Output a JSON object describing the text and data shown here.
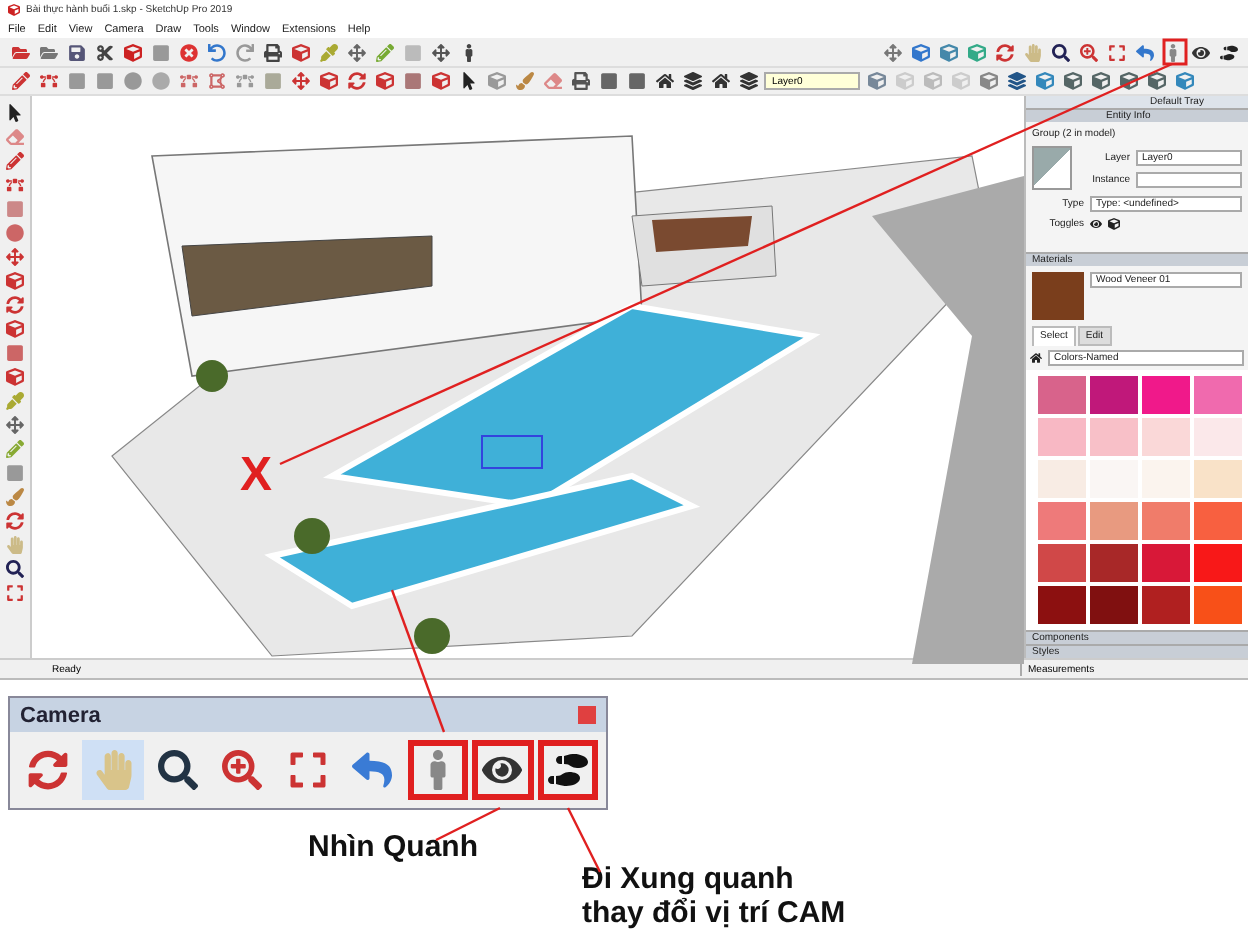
{
  "window": {
    "title": "Bài thực hành buổi 1.skp - SketchUp Pro 2019"
  },
  "menu": [
    "File",
    "Edit",
    "View",
    "Camera",
    "Draw",
    "Tools",
    "Window",
    "Extensions",
    "Help"
  ],
  "layer_field": {
    "value": "Layer0"
  },
  "viewport": {
    "marker": "X"
  },
  "tray": {
    "title": "Default Tray",
    "entity_info": {
      "title": "Entity Info",
      "heading": "Group (2 in model)",
      "layer_label": "Layer",
      "layer_value": "Layer0",
      "instance_label": "Instance",
      "type_label": "Type",
      "type_value": "Type: <undefined>",
      "toggles_label": "Toggles"
    },
    "materials": {
      "title": "Materials",
      "name": "Wood Veneer 01",
      "tabs": [
        {
          "label": "Select",
          "selected": true
        },
        {
          "label": "Edit",
          "selected": false
        }
      ],
      "library": "Colors-Named",
      "swatches": [
        {
          "color": "#d8638b"
        },
        {
          "color": "#c0187a"
        },
        {
          "color": "#f0198a"
        },
        {
          "color": "#f06aae"
        },
        {
          "color": "#f8b8c4"
        },
        {
          "color": "#f8c0c8"
        },
        {
          "color": "#fad8d8"
        },
        {
          "color": "#fbe8ea"
        },
        {
          "color": "#f8ece4"
        },
        {
          "color": "#faf6f4"
        },
        {
          "color": "#fbf4ee"
        },
        {
          "color": "#f9e2c8"
        },
        {
          "color": "#ee7a7a"
        },
        {
          "color": "#e89a80"
        },
        {
          "color": "#f07c6a"
        },
        {
          "color": "#f86040"
        },
        {
          "color": "#d04848"
        },
        {
          "color": "#a82828"
        },
        {
          "color": "#d81838"
        },
        {
          "color": "#f81818"
        },
        {
          "color": "#8c1010"
        },
        {
          "color": "#801010"
        },
        {
          "color": "#b02020"
        },
        {
          "color": "#f85018"
        }
      ]
    },
    "collapsed": [
      {
        "title": "Components"
      },
      {
        "title": "Styles"
      }
    ]
  },
  "status_bar": {
    "text": "Ready",
    "measurements": "Measurements"
  },
  "camera": {
    "title": "Camera",
    "tools": [
      {
        "kind": "orbit",
        "selected": false,
        "outlined": false
      },
      {
        "kind": "pan",
        "selected": true,
        "outlined": false
      },
      {
        "kind": "zoom",
        "selected": false,
        "outlined": false
      },
      {
        "kind": "zoom_window",
        "selected": false,
        "outlined": false
      },
      {
        "kind": "zoom_extents",
        "selected": false,
        "outlined": false
      },
      {
        "kind": "previous",
        "selected": false,
        "outlined": false
      },
      {
        "kind": "position",
        "selected": false,
        "outlined": true
      },
      {
        "kind": "look_around",
        "selected": false,
        "outlined": true
      },
      {
        "kind": "walk",
        "selected": false,
        "outlined": true
      }
    ]
  },
  "captions": [
    {
      "lines": [
        "Nhìn Quanh"
      ]
    },
    {
      "lines": [
        "Đi Xung quanh",
        "thay đổi vị trí CAM"
      ]
    }
  ]
}
